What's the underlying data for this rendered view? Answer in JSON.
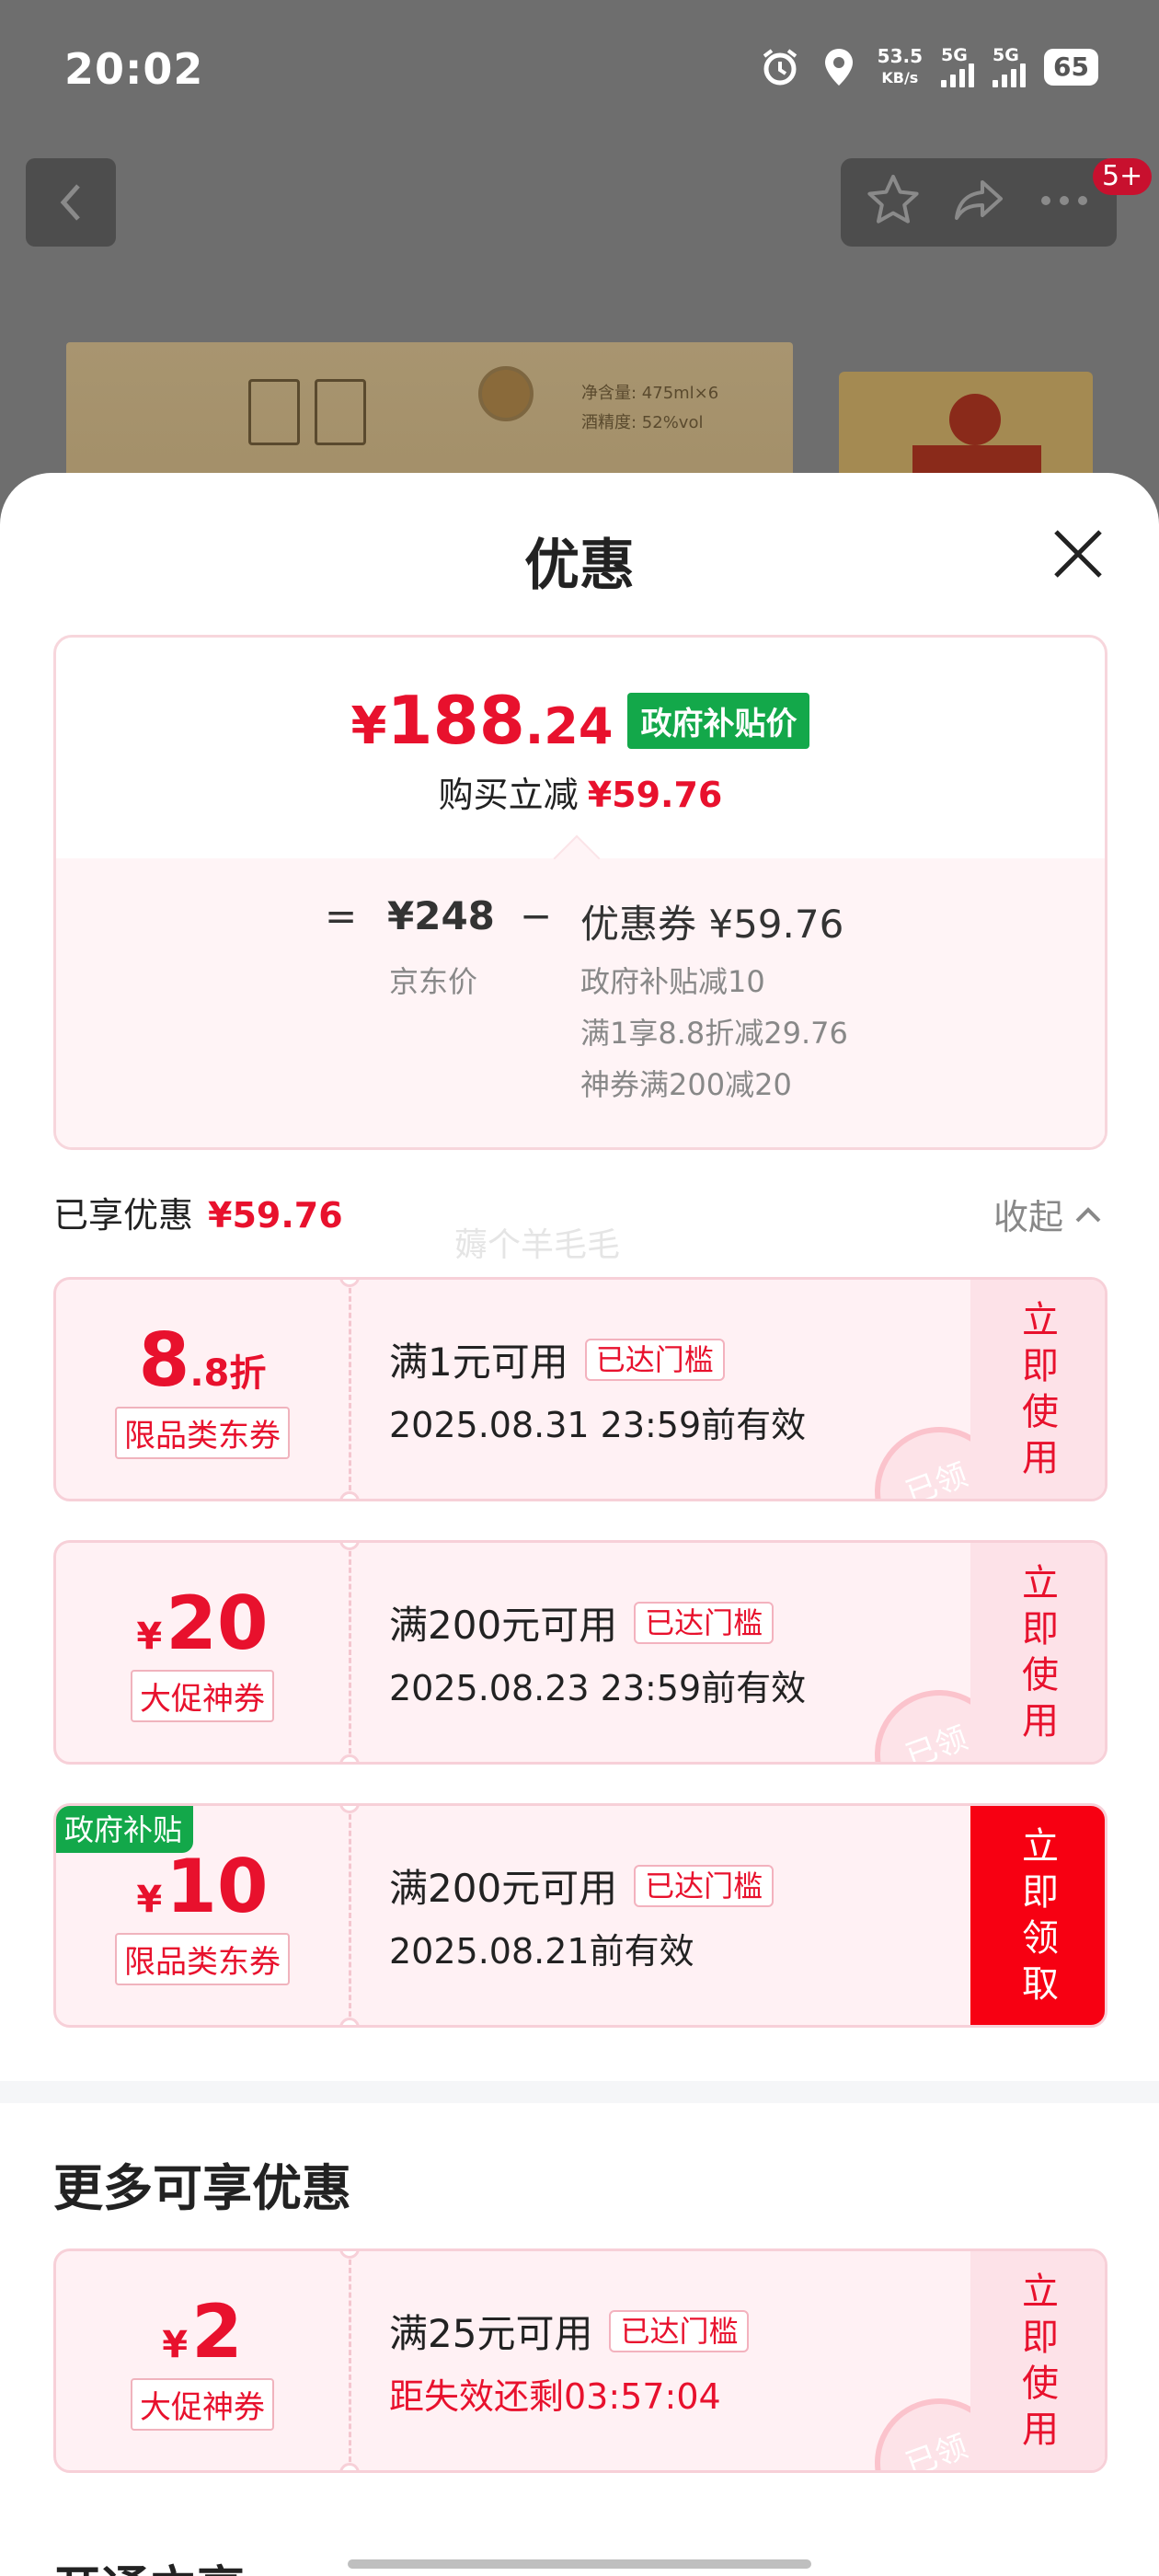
{
  "status_bar": {
    "time": "20:02",
    "net_speed_value": "53.5",
    "net_speed_unit": "KB/s",
    "signal_1": "5G",
    "signal_2": "5G",
    "battery": "65"
  },
  "nav": {
    "badge": "5+"
  },
  "background_product": {
    "spec_line_1": "净含量: 475ml×6",
    "spec_line_2": "酒精度: 52%vol"
  },
  "sheet": {
    "title": "优惠"
  },
  "price_summary": {
    "currency": "¥",
    "price_int": "188",
    "price_dec": ".24",
    "gov_tag": "政府补贴价",
    "reduce_label": "购买立减",
    "reduce_amount": "¥59.76",
    "eq": "=",
    "jd_price": "¥248",
    "minus": "−",
    "coupon_label": "优惠券 ¥59.76",
    "jd_price_label": "京东价",
    "discounts": [
      "政府补贴减10",
      "满1享8.8折减29.76",
      "神券满200减20"
    ]
  },
  "enjoyed": {
    "label": "已享优惠",
    "amount": "¥59.76",
    "collapse": "收起",
    "watermark": "薅个羊毛毛"
  },
  "coupons": [
    {
      "yen": "",
      "num": "8",
      "unit": ".8折",
      "type": "限品类东券",
      "condition": "满1元可用",
      "reached": "已达门槛",
      "valid": "2025.08.31 23:59前有效",
      "action": "立即使用",
      "stamp": "已领",
      "gov_corner": ""
    },
    {
      "yen": "¥",
      "num": "20",
      "unit": "",
      "type": "大促神券",
      "condition": "满200元可用",
      "reached": "已达门槛",
      "valid": "2025.08.23 23:59前有效",
      "action": "立即使用",
      "stamp": "已领",
      "gov_corner": ""
    },
    {
      "yen": "¥",
      "num": "10",
      "unit": "",
      "type": "限品类东券",
      "condition": "满200元可用",
      "reached": "已达门槛",
      "valid": "2025.08.21前有效",
      "action": "立即领取",
      "stamp": "",
      "gov_corner": "政府补贴"
    }
  ],
  "more": {
    "title": "更多可享优惠",
    "coupon": {
      "yen": "¥",
      "num": "2",
      "type": "大促神券",
      "condition": "满25元可用",
      "reached": "已达门槛",
      "countdown": "距失效还剩03:57:04",
      "action": "立即使用",
      "stamp": "已领"
    }
  },
  "bottom_peek": "开通立享"
}
